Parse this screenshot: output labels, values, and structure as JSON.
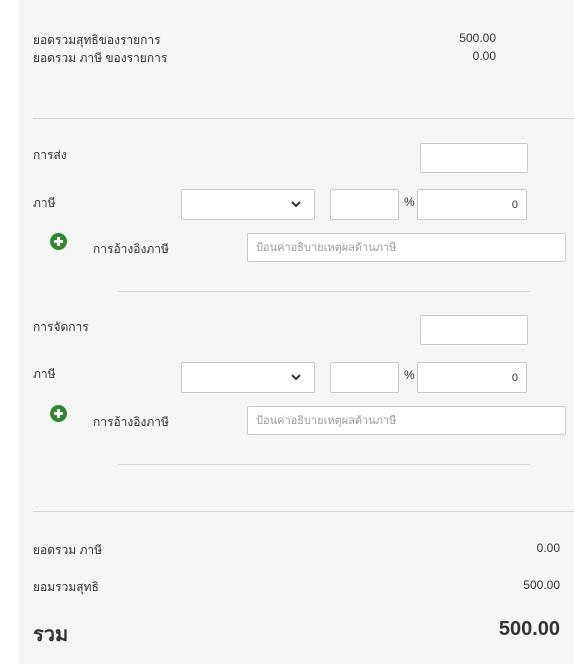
{
  "summary_top": {
    "net_items_label": "ยอดรวมสุทธิของรายการ",
    "net_items_value": "500.00",
    "tax_items_label": "ยอดรวม ภาษี ของรายการ",
    "tax_items_value": "0.00"
  },
  "shipping": {
    "label": "การส่ง",
    "amount_value": "",
    "tax_label": "ภาษี",
    "tax_select_value": "",
    "tax_percent_value": "",
    "percent_sign": "%",
    "tax_amount_value": "0",
    "tax_reference_label": "การอ้างอิงภาษี",
    "tax_reference_placeholder": "ป้อนค่าอธิบายเหตุผลด้านภาษี"
  },
  "handling": {
    "label": "การจัดการ",
    "amount_value": "",
    "tax_label": "ภาษี",
    "tax_select_value": "",
    "tax_percent_value": "",
    "percent_sign": "%",
    "tax_amount_value": "0",
    "tax_reference_label": "การอ้างอิงภาษี",
    "tax_reference_placeholder": "ป้อนค่าอธิบายเหตุผลด้านภาษี"
  },
  "totals": {
    "tax_total_label": "ยอดรวม ภาษี",
    "tax_total_value": "0.00",
    "net_total_label": "ยอมรวมสุทธิ",
    "net_total_value": "500.00",
    "grand_total_label": "รวม",
    "grand_total_value": "500.00"
  },
  "icons": {
    "add_tax_reference": "plus-circle-icon",
    "select_arrow": "chevron-down-icon"
  },
  "colors": {
    "panel_background": "#f5f5f5",
    "add_icon_green": "#2b8a2b",
    "divider": "#d6d6d6"
  }
}
